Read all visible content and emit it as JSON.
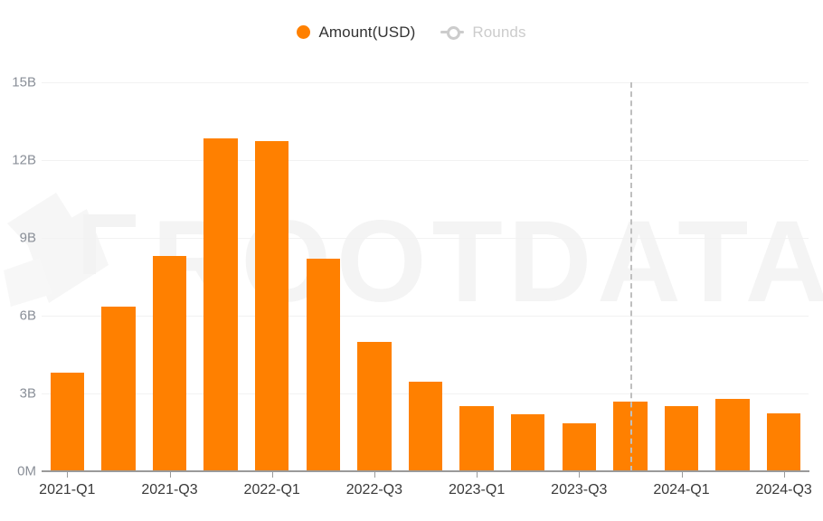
{
  "legend": {
    "position": "top-center",
    "items": [
      {
        "label": "Amount(USD)",
        "marker": "filled-circle",
        "color": "#ff8000",
        "active": true
      },
      {
        "label": "Rounds",
        "marker": "line-circle",
        "color": "#cccccc",
        "active": false
      }
    ]
  },
  "watermark": {
    "text": "ROOTDATA",
    "color": "#f4f4f4"
  },
  "annotation": {
    "marker_line_category": "2023-Q4",
    "style": "dashed",
    "color": "#bfbfbf"
  },
  "chart_data": {
    "type": "bar",
    "title": "",
    "subtitle": "",
    "xlabel": "",
    "ylabel": "",
    "grid": true,
    "legend_position": "top-center",
    "bar_color": "#ff8000",
    "ylim": [
      0,
      15000000000
    ],
    "ytick_labels": [
      "0M",
      "3B",
      "6B",
      "9B",
      "12B",
      "15B"
    ],
    "ytick_values": [
      0,
      3000000000,
      6000000000,
      9000000000,
      12000000000,
      15000000000
    ],
    "xtick_labels": [
      "2021-Q1",
      "2021-Q3",
      "2022-Q1",
      "2022-Q3",
      "2023-Q1",
      "2023-Q3",
      "2024-Q1",
      "2024-Q3"
    ],
    "categories": [
      "2021-Q1",
      "2021-Q2",
      "2021-Q3",
      "2021-Q4",
      "2022-Q1",
      "2022-Q2",
      "2022-Q3",
      "2022-Q4",
      "2023-Q1",
      "2023-Q2",
      "2023-Q3",
      "2023-Q4",
      "2024-Q1",
      "2024-Q2",
      "2024-Q3"
    ],
    "series": [
      {
        "name": "Amount(USD)",
        "unit": "USD",
        "values": [
          3800000000,
          6350000000,
          8300000000,
          12850000000,
          12750000000,
          8200000000,
          5000000000,
          3450000000,
          2500000000,
          2200000000,
          1850000000,
          2700000000,
          2500000000,
          2800000000,
          2250000000
        ],
        "labels": [
          "3.8B",
          "6.35B",
          "8.3B",
          "12.85B",
          "12.75B",
          "8.2B",
          "5.0B",
          "3.45B",
          "2.5B",
          "2.2B",
          "1.85B",
          "2.7B",
          "2.5B",
          "2.8B",
          "2.25B"
        ]
      },
      {
        "name": "Rounds",
        "hidden": true,
        "values": []
      }
    ]
  }
}
